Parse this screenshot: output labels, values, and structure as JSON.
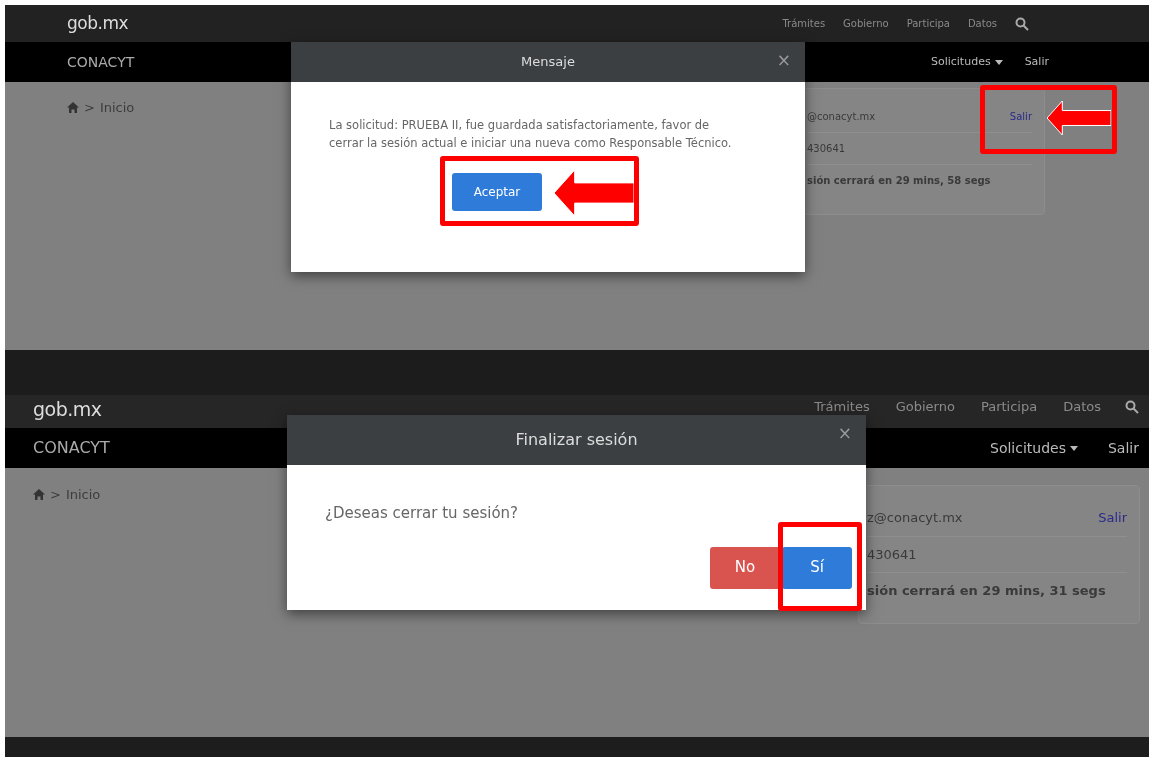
{
  "panels": [
    {
      "brand": "gob.mx",
      "nav_links": [
        "Trámites",
        "Gobierno",
        "Participa",
        "Datos"
      ],
      "subnav": {
        "title": "CONACYT",
        "menu": "Solicitudes",
        "logout": "Salir"
      },
      "breadcrumb": {
        "separator": ">",
        "label": "Inicio"
      },
      "account_card": {
        "email": "@conacyt.mx",
        "logout": "Salir",
        "logout_framed": true,
        "logout_arrow": true,
        "number": "430641",
        "timer": "sión cerrará en 29 mins, 58 segs"
      },
      "modal": {
        "title": "Mensaje",
        "close": "×",
        "message": "La solicitud: PRUEBA II, fue guardada satisfactoriamente, favor de cerrar la sesión actual e iniciar una nueva como Responsable Técnico.",
        "buttons": [
          {
            "label": "Aceptar",
            "kind": "primary",
            "framed": true,
            "arrow": true
          }
        ]
      }
    },
    {
      "brand": "gob.mx",
      "nav_links": [
        "Trámites",
        "Gobierno",
        "Participa",
        "Datos"
      ],
      "subnav": {
        "title": "CONACYT",
        "menu": "Solicitudes",
        "logout": "Salir"
      },
      "breadcrumb": {
        "separator": ">",
        "label": "Inicio"
      },
      "account_card": {
        "email": "z@conacyt.mx",
        "logout": "Salir",
        "logout_framed": false,
        "logout_arrow": false,
        "number": "430641",
        "timer": "sión cerrará en 29 mins, 31 segs"
      },
      "modal": {
        "title": "Finalizar sesión",
        "close": "×",
        "message": "¿Deseas cerrar tu sesión?",
        "buttons": [
          {
            "label": "No",
            "kind": "danger",
            "framed": false,
            "arrow": false
          },
          {
            "label": "Sí",
            "kind": "primary",
            "framed": true,
            "arrow": false
          }
        ]
      }
    }
  ]
}
